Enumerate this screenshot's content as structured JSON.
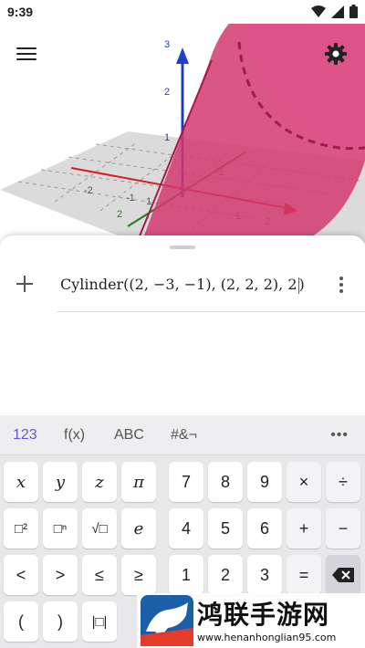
{
  "status_bar": {
    "time": "9:39"
  },
  "graphics": {
    "axis_ticks_z": [
      "3",
      "2",
      "1"
    ],
    "axis_ticks_x": [
      "-2",
      "-1",
      "1",
      "2"
    ],
    "axis_ticks_y": [
      "2",
      "1",
      "-1"
    ],
    "colors": {
      "surface": "#d3386f",
      "axis_z": "#1f3fc9",
      "axis_x": "#d62020",
      "axis_y": "#1e7f1e"
    }
  },
  "algebra": {
    "input_value": "Cylinder((2, −3, −1), (2, 2, 2), 2"
  },
  "keyboard": {
    "tabs": [
      "123",
      "f(x)",
      "ABC",
      "#&¬"
    ],
    "active_tab": "123",
    "more": "•••",
    "keys": {
      "x": "x",
      "y": "y",
      "z": "z",
      "pi": "π",
      "seven": "7",
      "eight": "8",
      "nine": "9",
      "times": "×",
      "divide": "÷",
      "square": "□²",
      "power": "□ⁿ",
      "sqrt": "√□",
      "e": "e",
      "four": "4",
      "five": "5",
      "six": "6",
      "plus": "+",
      "minus": "−",
      "lt": "<",
      "gt": ">",
      "le": "≤",
      "ge": "≥",
      "one": "1",
      "two": "2",
      "three": "3",
      "equals": "=",
      "lparen": "(",
      "rparen": ")",
      "abs": "|□|"
    }
  },
  "watermark": {
    "text": "鸿联手游网",
    "url": "www.henanhonglian95.com"
  }
}
